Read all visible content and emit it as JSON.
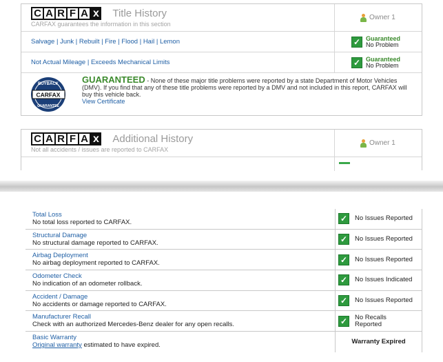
{
  "title_history": {
    "logo_letters": [
      "C",
      "A",
      "R",
      "F",
      "A"
    ],
    "logo_x": "x",
    "title": "Title History",
    "subtitle": "CARFAX guarantees the information in this section",
    "owner": "Owner 1",
    "rows": [
      {
        "label": "Salvage | Junk | Rebuilt | Fire | Flood | Hail | Lemon",
        "status_top": "Guaranteed",
        "status_bottom": "No Problem"
      },
      {
        "label": "Not Actual Mileage | Exceeds Mechanical Limits",
        "status_top": "Guaranteed",
        "status_bottom": "No Problem"
      }
    ],
    "guarantee": {
      "heading": "GUARANTEED",
      "text": " - None of these major title problems were reported by a state Department of Motor Vehicles (DMV). If you find that any of these title problems were reported by a DMV and not included in this report, CARFAX will buy this vehicle back.",
      "link": "View Certificate",
      "seal_top": "BUYBACK",
      "seal_mid": "CARFAX",
      "seal_bottom": "GUARANTEE"
    }
  },
  "additional_history": {
    "logo_letters": [
      "C",
      "A",
      "R",
      "F",
      "A"
    ],
    "logo_x": "x",
    "title": "Additional History",
    "subtitle": "Not all accidents / issues are reported to CARFAX",
    "owner": "Owner 1"
  },
  "items": [
    {
      "title": "Total Loss",
      "desc": "No total loss reported to CARFAX.",
      "status": "No Issues Reported"
    },
    {
      "title": "Structural Damage",
      "desc": "No structural damage reported to CARFAX.",
      "status": "No Issues Reported"
    },
    {
      "title": "Airbag Deployment",
      "desc": "No airbag deployment reported to CARFAX.",
      "status": "No Issues Reported"
    },
    {
      "title": "Odometer Check",
      "desc": "No indication of an odometer rollback.",
      "status": "No Issues Indicated"
    },
    {
      "title": "Accident / Damage",
      "desc": "No accidents or damage reported to CARFAX.",
      "status": "No Issues Reported"
    },
    {
      "title": "Manufacturer Recall",
      "desc": "Check with an authorized Mercedes-Benz dealer for any open recalls.",
      "status_top": "No Recalls",
      "status_bottom": "Reported"
    }
  ],
  "warranty": {
    "title": "Basic Warranty",
    "link": "Original warranty",
    "desc": " estimated to have expired.",
    "status": "Warranty Expired"
  },
  "check_glyph": "✓"
}
